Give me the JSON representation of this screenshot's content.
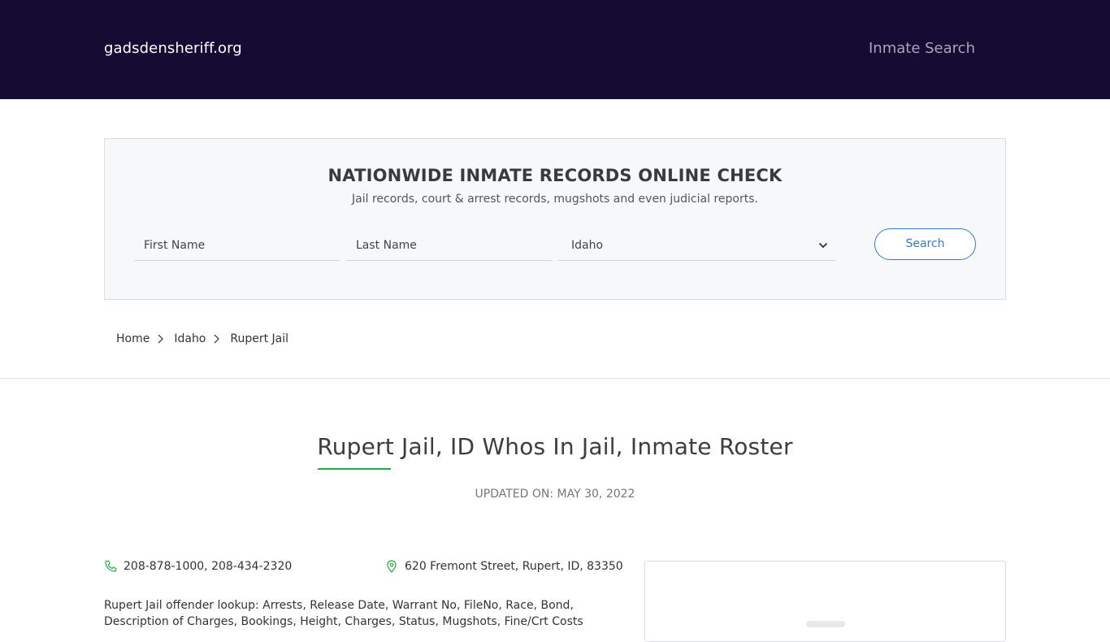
{
  "header": {
    "brand": "gadsdensheriff.org",
    "nav_link": "Inmate Search",
    "bg_color": "#150b33"
  },
  "search": {
    "title": "NATIONWIDE INMATE RECORDS ONLINE CHECK",
    "subtitle": "Jail records, court & arrest records, mugshots and even judicial reports.",
    "first_name_placeholder": "First Name",
    "last_name_placeholder": "Last Name",
    "state_selected": "Idaho",
    "button_label": "Search",
    "accent_color": "#3a78c4"
  },
  "breadcrumb": {
    "items": [
      "Home",
      "Idaho",
      "Rupert Jail"
    ]
  },
  "page": {
    "title": "Rupert Jail, ID Whos In Jail, Inmate Roster",
    "updated": "UPDATED ON: MAY 30, 2022",
    "underline_color": "#2aa845"
  },
  "contact": {
    "phone": "208-878-1000, 208-434-2320",
    "address": "620 Fremont Street, Rupert, ID, 83350",
    "icon_color": "#2aa845"
  },
  "description": "Rupert Jail offender lookup: Arrests, Release Date, Warrant No, FileNo, Race, Bond, Description of Charges, Bookings, Height, Charges, Status, Mugshots, Fine/Crt Costs"
}
